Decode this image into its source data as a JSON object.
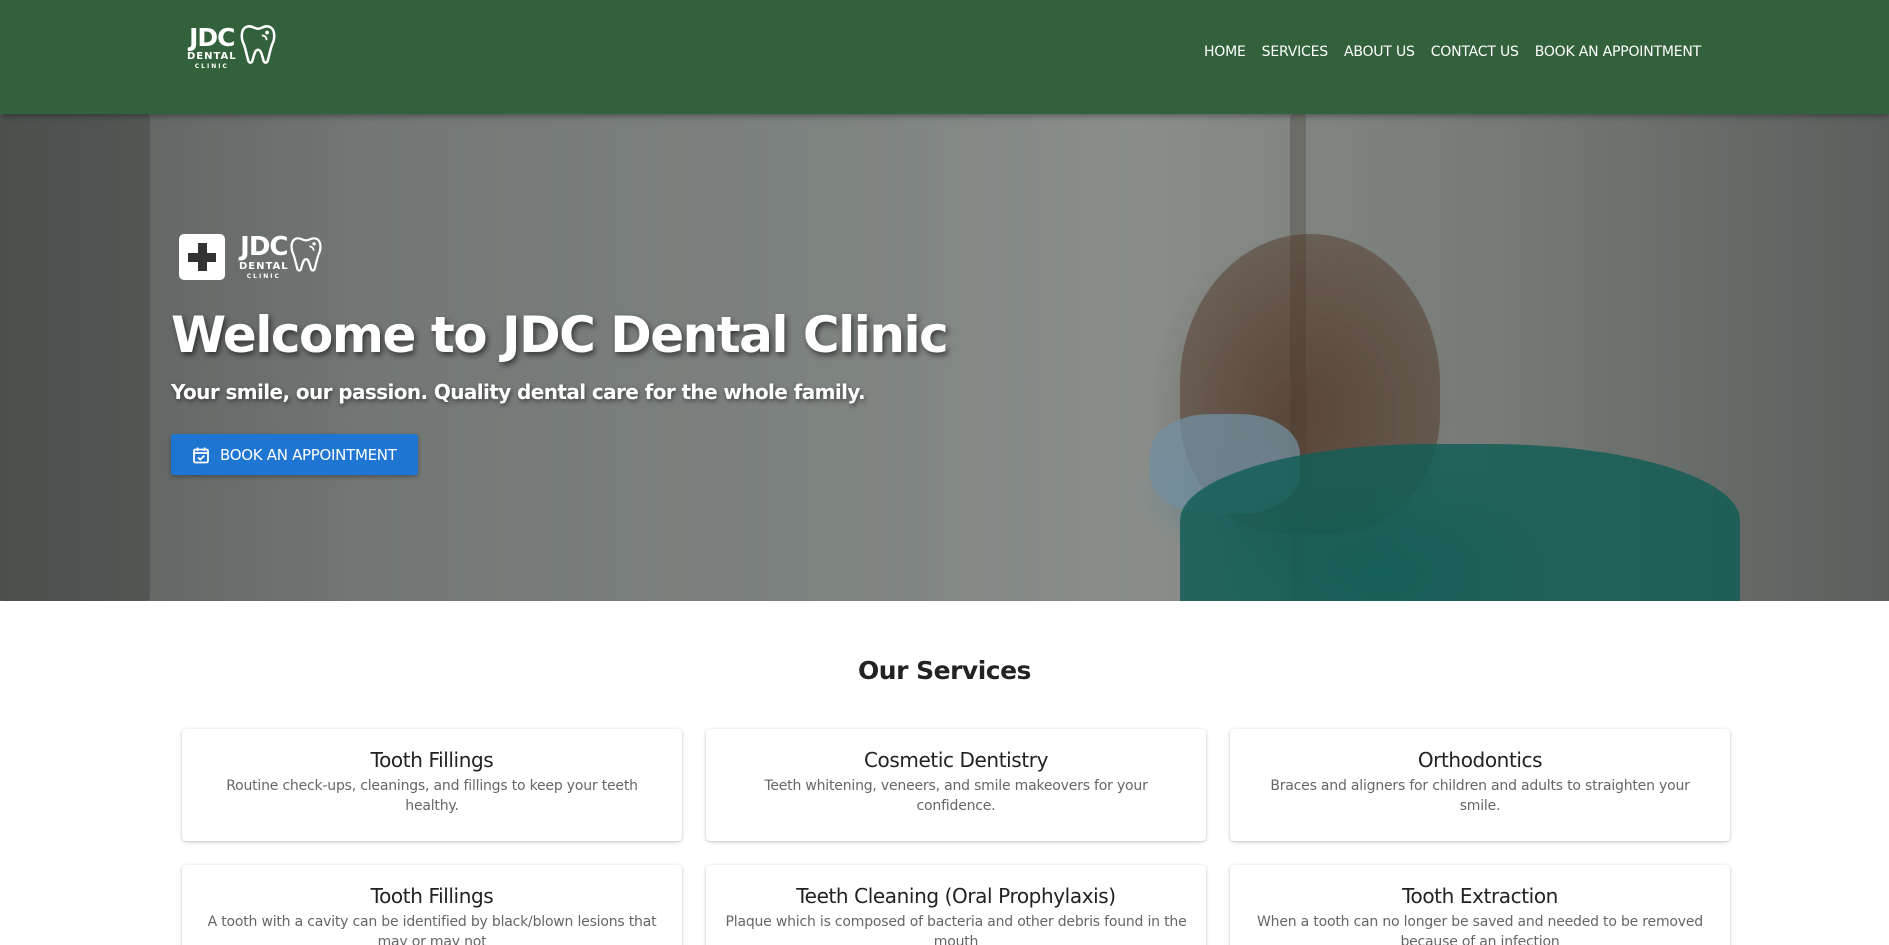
{
  "brand": {
    "jdc": "JDC",
    "dental": "DENTAL",
    "clinic": "CLINIC"
  },
  "nav": {
    "items": [
      "HOME",
      "SERVICES",
      "ABOUT US",
      "CONTACT US",
      "BOOK AN APPOINTMENT"
    ]
  },
  "hero": {
    "title": "Welcome to JDC Dental Clinic",
    "subtitle": "Your smile, our passion. Quality dental care for the whole family.",
    "button_label": "BOOK AN APPOINTMENT",
    "button_icon": "calendar-check-icon"
  },
  "services": {
    "heading": "Our Services",
    "cards": [
      {
        "name": "Tooth Fillings",
        "desc": "Routine check-ups, cleanings, and fillings to keep your teeth healthy."
      },
      {
        "name": "Cosmetic Dentistry",
        "desc": "Teeth whitening, veneers, and smile makeovers for your confidence."
      },
      {
        "name": "Orthodontics",
        "desc": "Braces and aligners for children and adults to straighten your smile."
      },
      {
        "name": "Tooth Fillings",
        "desc": "A tooth with a cavity can be identified by black/blown lesions that may or may not"
      },
      {
        "name": "Teeth Cleaning (Oral Prophylaxis)",
        "desc": "Plaque which is composed of bacteria and other debris found in the mouth"
      },
      {
        "name": "Tooth Extraction",
        "desc": "When a tooth can no longer be saved and needed to be removed because of an infection"
      }
    ]
  },
  "colors": {
    "header_bg": "#33613b",
    "button_bg": "#1f76d2"
  }
}
